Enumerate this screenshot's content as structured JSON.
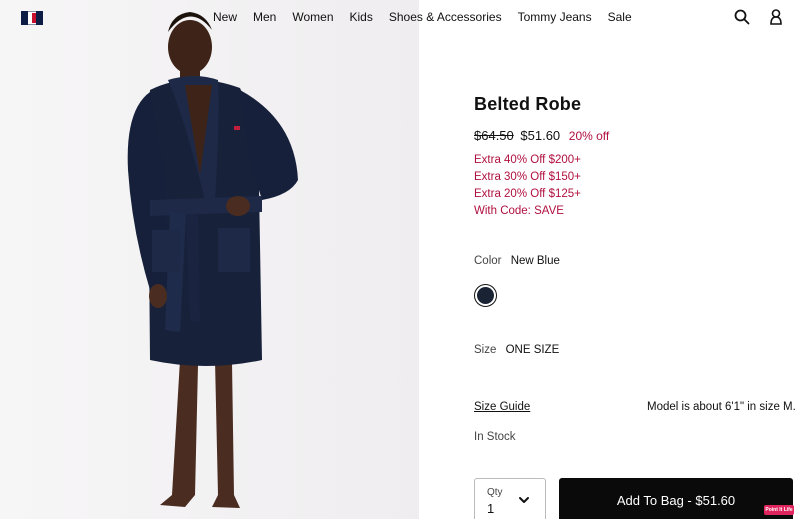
{
  "header": {
    "logo_icon": "tommy-hilfiger-flag-logo",
    "nav": [
      "New",
      "Men",
      "Women",
      "Kids",
      "Shoes & Accessories",
      "Tommy Jeans",
      "Sale"
    ],
    "icons": [
      "search-icon",
      "account-icon"
    ]
  },
  "product": {
    "title": "Belted Robe",
    "price_original": "$64.50",
    "price_sale": "$51.60",
    "discount": "20% off",
    "promos": [
      "Extra 40% Off $200+",
      "Extra 30% Off $150+",
      "Extra 20% Off $125+",
      "With Code: SAVE"
    ],
    "color_label": "Color",
    "color_value": "New Blue",
    "swatch_color": "#1a2334",
    "size_label": "Size",
    "size_value": "ONE SIZE",
    "size_guide": "Size Guide",
    "model_info": "Model is about 6'1\" in size M.",
    "stock": "In Stock",
    "qty_label": "Qty",
    "qty_value": "1",
    "add_to_bag": "Add To Bag - $51.60",
    "badge": "Point It Life"
  },
  "colors": {
    "promo": "#b0103f",
    "button": "#0a0a0a"
  }
}
